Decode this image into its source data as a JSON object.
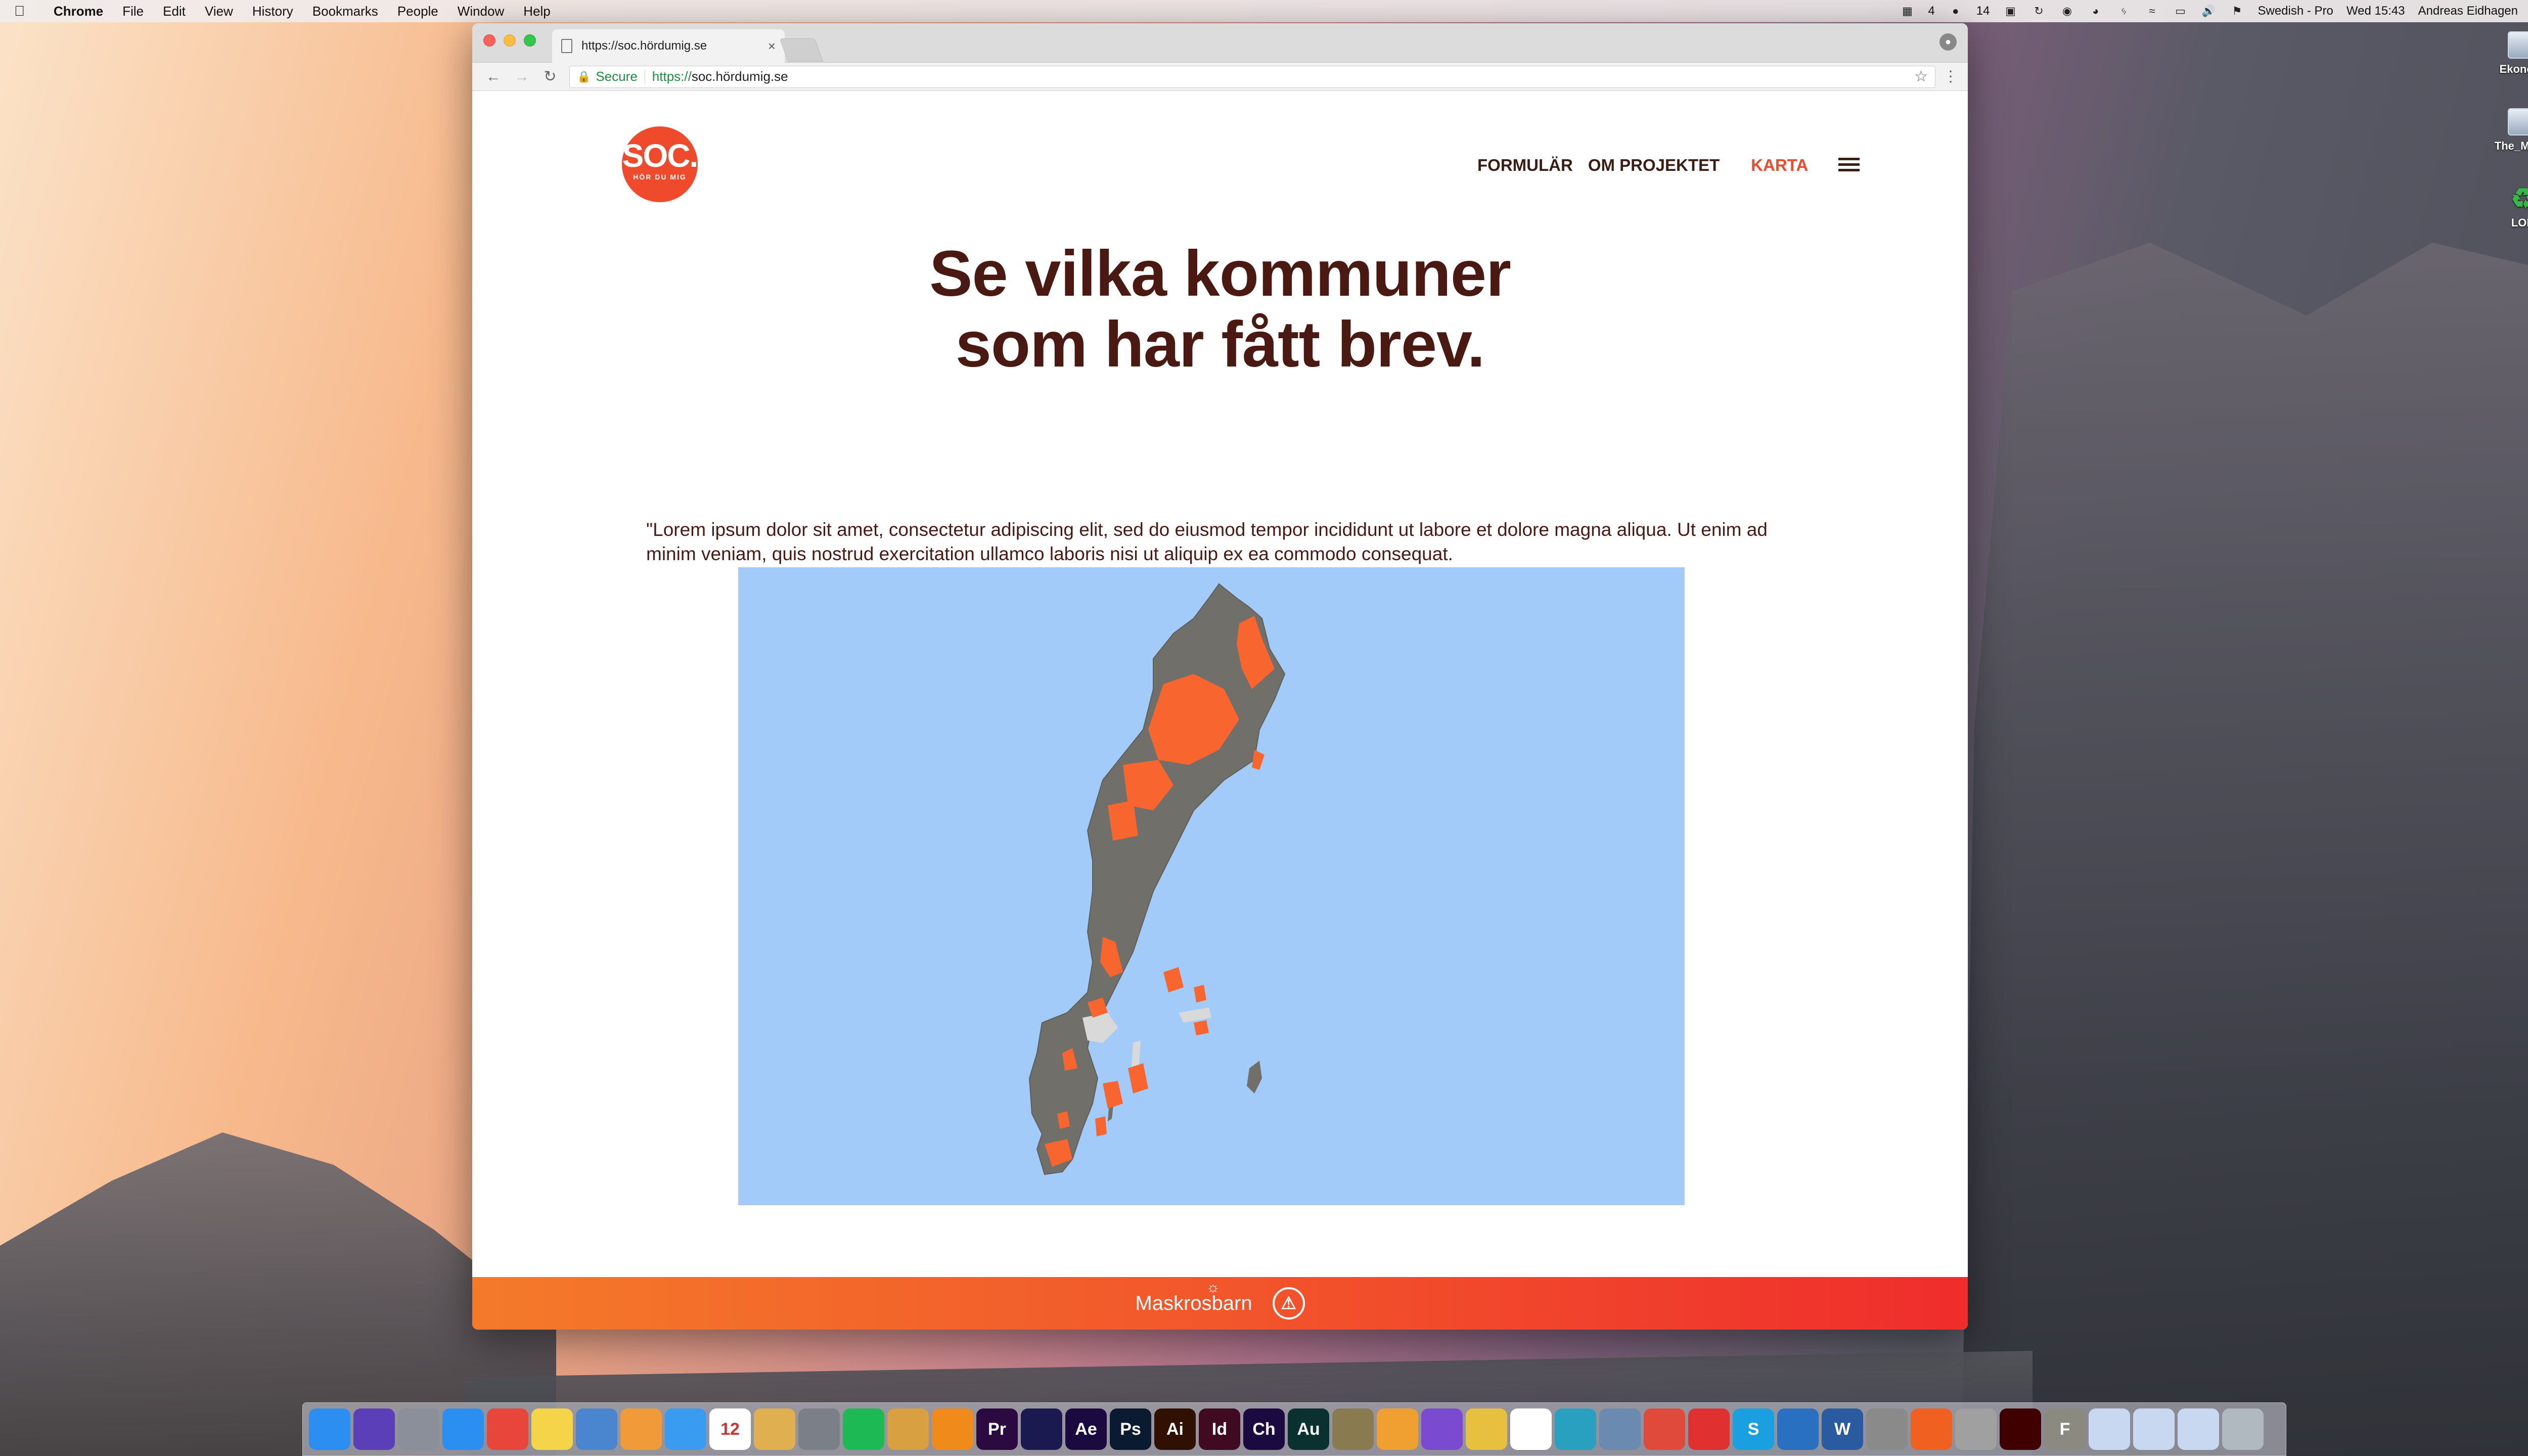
{
  "menubar": {
    "app_name": "Chrome",
    "menus": [
      "File",
      "Edit",
      "View",
      "History",
      "Bookmarks",
      "People",
      "Window",
      "Help"
    ],
    "status_items": [
      "4",
      "14"
    ],
    "keyboard": "Swedish - Pro",
    "clock": "Wed 15:43",
    "user": "Andreas Eidhagen"
  },
  "desktop": {
    "icons": [
      {
        "label": "Ekonomi",
        "icon": "drive-icon"
      },
      {
        "label": "The_Motor",
        "icon": "drive-icon"
      },
      {
        "label": "LOD",
        "icon": "recycle-icon"
      }
    ]
  },
  "browser": {
    "tab_title": "https://soc.hördumig.se",
    "secure_label": "Secure",
    "url_scheme": "https://",
    "url_host": "soc.hördumig.se"
  },
  "site": {
    "logo_main": "SOC.",
    "logo_sub": "HÖR DU MIG",
    "nav": [
      "FORMULÄR",
      "OM PROJEKTET"
    ],
    "nav_active": "KARTA",
    "headline_line1": "Se vilka kommuner",
    "headline_line2": "som har fått brev.",
    "lede": "\"Lorem ipsum dolor sit amet, consectetur adipiscing elit, sed do eiusmod tempor incididunt ut labore et dolore magna aliqua. Ut enim ad minim veniam, quis nostrud exercitation ullamco laboris nisi ut aliquip ex ea commodo consequat.",
    "map": {
      "water_color": "#a2cbfa",
      "land_color": "#706f6a",
      "highlight_color": "#f9652f"
    },
    "footer_brand": "Maskrosbarn",
    "footer_badge": "⚠"
  },
  "dock": {
    "apps": [
      {
        "name": "finder",
        "label": "",
        "color": "#2b8ef0"
      },
      {
        "name": "siri",
        "label": "",
        "color": "#5a3fb8"
      },
      {
        "name": "launchpad",
        "label": "",
        "color": "#8a8f99"
      },
      {
        "name": "safari",
        "label": "",
        "color": "#2a8ff0"
      },
      {
        "name": "chrome",
        "label": "",
        "color": "#e8463a"
      },
      {
        "name": "notes",
        "label": "",
        "color": "#f5d44a"
      },
      {
        "name": "preview",
        "label": "",
        "color": "#4a86d0"
      },
      {
        "name": "photos",
        "label": "",
        "color": "#f09a3a"
      },
      {
        "name": "messages",
        "label": "",
        "color": "#3a9cf0"
      },
      {
        "name": "calendar",
        "label": "12",
        "color": "#ffffff"
      },
      {
        "name": "textedit",
        "label": "",
        "color": "#e0b050"
      },
      {
        "name": "system-preferences",
        "label": "",
        "color": "#7a7f88"
      },
      {
        "name": "spotify",
        "label": "",
        "color": "#1db954"
      },
      {
        "name": "beer",
        "label": "",
        "color": "#d8a040"
      },
      {
        "name": "vlc",
        "label": "",
        "color": "#f08a1a"
      },
      {
        "name": "premiere",
        "label": "Pr",
        "color": "#2a0a40"
      },
      {
        "name": "media-encoder",
        "label": "",
        "color": "#1a1a50"
      },
      {
        "name": "after-effects",
        "label": "Ae",
        "color": "#1a0a40"
      },
      {
        "name": "photoshop",
        "label": "Ps",
        "color": "#0a1a30"
      },
      {
        "name": "illustrator",
        "label": "Ai",
        "color": "#301000"
      },
      {
        "name": "indesign",
        "label": "Id",
        "color": "#400a20"
      },
      {
        "name": "character-animator",
        "label": "Ch",
        "color": "#1a0a40"
      },
      {
        "name": "audition",
        "label": "Au",
        "color": "#0a3030"
      },
      {
        "name": "archive",
        "label": "",
        "color": "#8a7a50"
      },
      {
        "name": "ibooks",
        "label": "",
        "color": "#f0a030"
      },
      {
        "name": "omnifocus",
        "label": "",
        "color": "#7a4ad0"
      },
      {
        "name": "stickies",
        "label": "",
        "color": "#e8c040"
      },
      {
        "name": "script-editor",
        "label": "",
        "color": "#ffffff"
      },
      {
        "name": "scanner",
        "label": "",
        "color": "#2aa0c0"
      },
      {
        "name": "mail-app",
        "label": "",
        "color": "#6a8ab0"
      },
      {
        "name": "todoist",
        "label": "",
        "color": "#e04a3a"
      },
      {
        "name": "power",
        "label": "",
        "color": "#e03030"
      },
      {
        "name": "skype",
        "label": "S",
        "color": "#1aa0e0"
      },
      {
        "name": "onedrive",
        "label": "",
        "color": "#2a70c0"
      },
      {
        "name": "word",
        "label": "W",
        "color": "#2a5aa0"
      },
      {
        "name": "utility",
        "label": "",
        "color": "#8a8a8a"
      },
      {
        "name": "firewall",
        "label": "",
        "color": "#f06020"
      },
      {
        "name": "automator",
        "label": "",
        "color": "#a0a0a0"
      },
      {
        "name": "acrobat",
        "label": "",
        "color": "#400000"
      },
      {
        "name": "font-book",
        "label": "F",
        "color": "#8a8a80"
      },
      {
        "name": "folder-1",
        "label": "",
        "color": "#c8d8f0"
      },
      {
        "name": "folder-2",
        "label": "",
        "color": "#c8d8f0"
      },
      {
        "name": "folder-3",
        "label": "",
        "color": "#c8d8f0"
      },
      {
        "name": "trash",
        "label": "",
        "color": "#b0b8c0"
      }
    ]
  }
}
